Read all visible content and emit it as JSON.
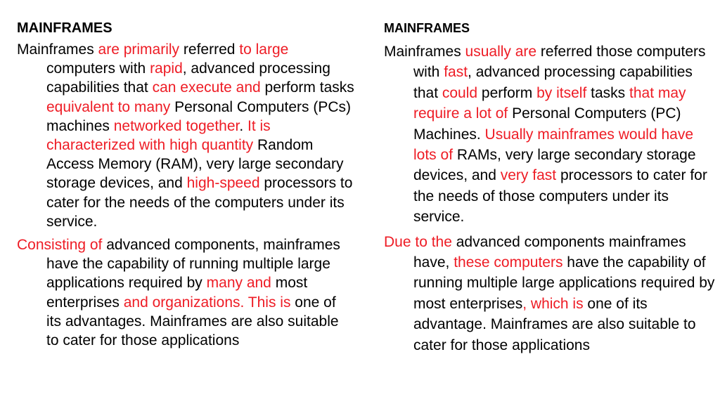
{
  "colors": {
    "edit": "#ee1c25",
    "text": "#000000",
    "background": "#ffffff"
  },
  "left": {
    "heading": "MAINFRAMES",
    "paragraphs": [
      [
        {
          "text": "Mainframes ",
          "style": "k"
        },
        {
          "text": "are primarily",
          "style": "r"
        },
        {
          "text": " referred ",
          "style": "k"
        },
        {
          "text": "to large",
          "style": "r"
        },
        {
          "text": " computers with ",
          "style": "k"
        },
        {
          "text": "rapid",
          "style": "r"
        },
        {
          "text": ", advanced processing capabilities that ",
          "style": "k"
        },
        {
          "text": "can execute and",
          "style": "r"
        },
        {
          "text": " perform tasks ",
          "style": "k"
        },
        {
          "text": "equivalent to many",
          "style": "r"
        },
        {
          "text": " Personal Computers (PCs) machines ",
          "style": "k"
        },
        {
          "text": "networked together",
          "style": "r"
        },
        {
          "text": ".  ",
          "style": "k"
        },
        {
          "text": "It is characterized with high quantity",
          "style": "r"
        },
        {
          "text": " Random Access Memory (RAM), very large secondary storage devices, and ",
          "style": "k"
        },
        {
          "text": "high-speed",
          "style": "r"
        },
        {
          "text": " processors to cater for the needs of the computers under its service.",
          "style": "k"
        }
      ],
      [
        {
          "text": "Consisting of",
          "style": "r"
        },
        {
          "text": " advanced components, mainframes have the capability of running multiple large applications required by ",
          "style": "k"
        },
        {
          "text": "many and",
          "style": "r"
        },
        {
          "text": " most enterprises ",
          "style": "k"
        },
        {
          "text": "and organizations.  This is",
          "style": "r"
        },
        {
          "text": " one of its advantages.  Mainframes are also suitable to cater for those applications",
          "style": "k"
        }
      ]
    ]
  },
  "right": {
    "heading": "MAINFRAMES",
    "paragraphs": [
      [
        {
          "text": "Mainframes ",
          "style": "k"
        },
        {
          "text": "usually are",
          "style": "r"
        },
        {
          "text": " referred those computers with ",
          "style": "k"
        },
        {
          "text": "fast",
          "style": "r"
        },
        {
          "text": ", advanced processing capabilities that ",
          "style": "k"
        },
        {
          "text": "could",
          "style": "r"
        },
        {
          "text": " perform ",
          "style": "k"
        },
        {
          "text": "by itself",
          "style": "r"
        },
        {
          "text": " tasks ",
          "style": "k"
        },
        {
          "text": "that may require a lot of",
          "style": "r"
        },
        {
          "text": " Personal Computers (PC) Machines. ",
          "style": "k"
        },
        {
          "text": "Usually mainframes would have lots of",
          "style": "r"
        },
        {
          "text": " RAMs, very large secondary storage devices, and ",
          "style": "k"
        },
        {
          "text": "very fast",
          "style": "r"
        },
        {
          "text": " processors to cater for the needs of those computers under its service.",
          "style": "k"
        }
      ],
      [
        {
          "text": "Due to the",
          "style": "r"
        },
        {
          "text": " advanced components mainframes have, ",
          "style": "k"
        },
        {
          "text": "these computers",
          "style": "r"
        },
        {
          "text": " have the capability of running multiple large applications required by most enterprises",
          "style": "k"
        },
        {
          "text": ", which is",
          "style": "r"
        },
        {
          "text": " one of its advantage. Mainframes are also suitable to cater for those applications",
          "style": "k"
        }
      ]
    ]
  }
}
